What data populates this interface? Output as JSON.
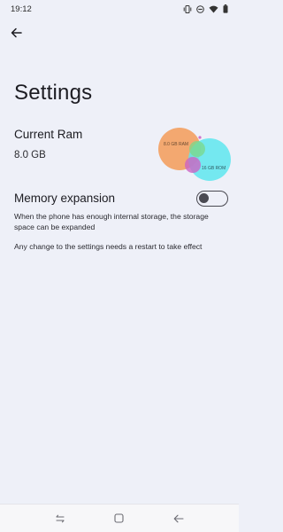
{
  "status_bar": {
    "time": "19:12",
    "icons": [
      "vibrate-icon",
      "dnd-icon",
      "wifi-icon",
      "battery-icon"
    ]
  },
  "header": {
    "back_icon": "back-arrow-icon",
    "title": "Settings"
  },
  "current_ram": {
    "label": "Current Ram",
    "value": "8.0 GB",
    "diagram": {
      "ram_label": "8.0 GB RAM",
      "rom_label": "16 GB ROM",
      "colors": {
        "ram": "#f3a060",
        "rom": "#5ee6ee",
        "overlap": "#cc64c4",
        "accent": "#7bd88a"
      }
    }
  },
  "memory_expansion": {
    "label": "Memory expansion",
    "toggle_on": false,
    "description": "When the phone has enough internal storage, the storage space can be expanded",
    "restart_note": "Any change to the settings needs a restart to take effect"
  },
  "nav_bar": {
    "icons": [
      "recents-icon",
      "home-icon",
      "back-icon"
    ]
  },
  "colors": {
    "background": "#eef0f8",
    "text": "#1c1c22",
    "toggle_off": "#4a4a52"
  }
}
